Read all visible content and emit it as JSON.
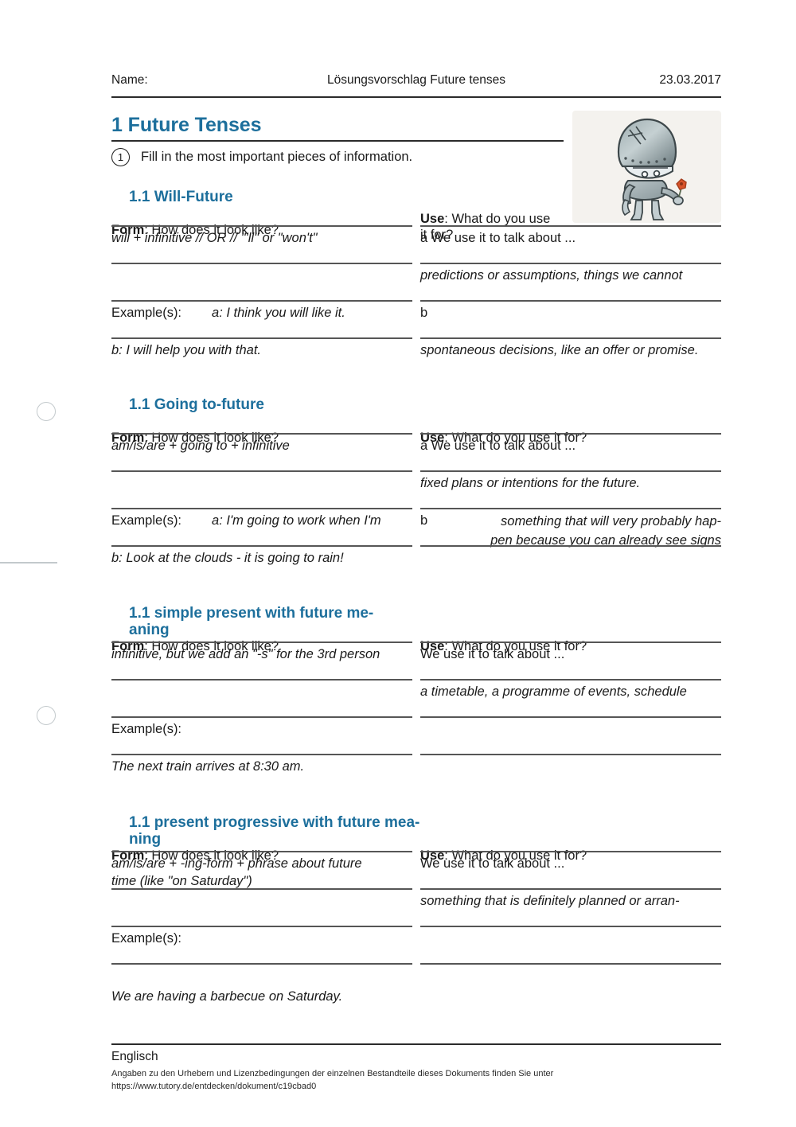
{
  "header": {
    "name_label": "Name:",
    "doc_title": "Lösungsvorschlag Future tenses",
    "date": "23.03.2017"
  },
  "title": "1 Future Tenses",
  "instruction": {
    "number": "1",
    "text": "Fill in the most important pieces of information."
  },
  "illustration": {
    "alt": "knight-in-armor-holding-flower"
  },
  "colors": {
    "heading_blue": "#1d6f9c",
    "rule_dark": "#2b2b2b",
    "rule_light": "#565656",
    "illustration_bg": "#f4f2ee"
  },
  "sections": [
    {
      "heading": "1.1 Will-Future",
      "form_label": "Form",
      "form_question": ": How does it look like?",
      "use_label": "Use",
      "use_question": ": What do you use\nit for?",
      "form_answer": "will + infinitive // OR // \"'ll\" or \"won't\"",
      "example_label": "Example(s):",
      "example_a": "a: I think you will  like it.",
      "example_b": "b: I will help you with that.",
      "use_a_marker": "a We use it to talk about ...",
      "use_a_answer": "predictions or assumptions, things we cannot",
      "use_b_marker": "b",
      "use_b_answer": "spontaneous decisions, like an offer or promise."
    },
    {
      "heading": "1.1 Going to-future",
      "form_label": "Form",
      "form_question": ": How does it look like?",
      "use_label": "Use",
      "use_question": ": What do you use it for?",
      "form_answer": "am/is/are + going to + infinitive",
      "example_label": "Example(s):",
      "example_a": "a: I'm going to work when I'm",
      "example_b": "b: Look at the clouds - it is going to rain!",
      "use_a_marker": "a We use it to talk about ...",
      "use_a_answer": "fixed plans or intentions for the future.",
      "use_b_marker": "b",
      "use_b_answer": "something that will very probably hap-\npen because you can already see signs"
    },
    {
      "heading": "1.1 simple present with future me-\naning",
      "form_label": "Form",
      "form_question": ": How does it look like?",
      "use_label": "Use",
      "use_question": ": What do you use it for?",
      "form_answer": "infinitive, but we add an \"-s\" for the 3rd person",
      "example_label": "Example(s):",
      "example_a": "",
      "example_b": "The next train arrives at 8:30 am.",
      "use_a_marker": "We use it to talk about ...",
      "use_a_answer": "a timetable, a programme of events, schedule",
      "use_b_marker": "",
      "use_b_answer": ""
    },
    {
      "heading": "1.1 present progressive with future mea-\nning",
      "form_label": "Form",
      "form_question": ": How does it look like?",
      "use_label": "Use",
      "use_question": ": What do you use it for?",
      "form_answer": "am/is/are + -ing-form + phrase about future\ntime (like \"on Saturday\")",
      "example_label": "Example(s):",
      "example_a": "",
      "example_b": "We are having a barbecue on Saturday.",
      "use_a_marker": "We use it to talk about ...",
      "use_a_answer": "something that is definitely planned or arran-",
      "use_b_marker": "",
      "use_b_answer": ""
    }
  ],
  "footer": {
    "subject": "Englisch",
    "credits_line1": "Angaben zu den Urhebern und Lizenzbedingungen der einzelnen Bestandteile dieses Dokuments finden Sie unter",
    "credits_line2": "https://www.tutory.de/entdecken/dokument/c19cbad0"
  }
}
